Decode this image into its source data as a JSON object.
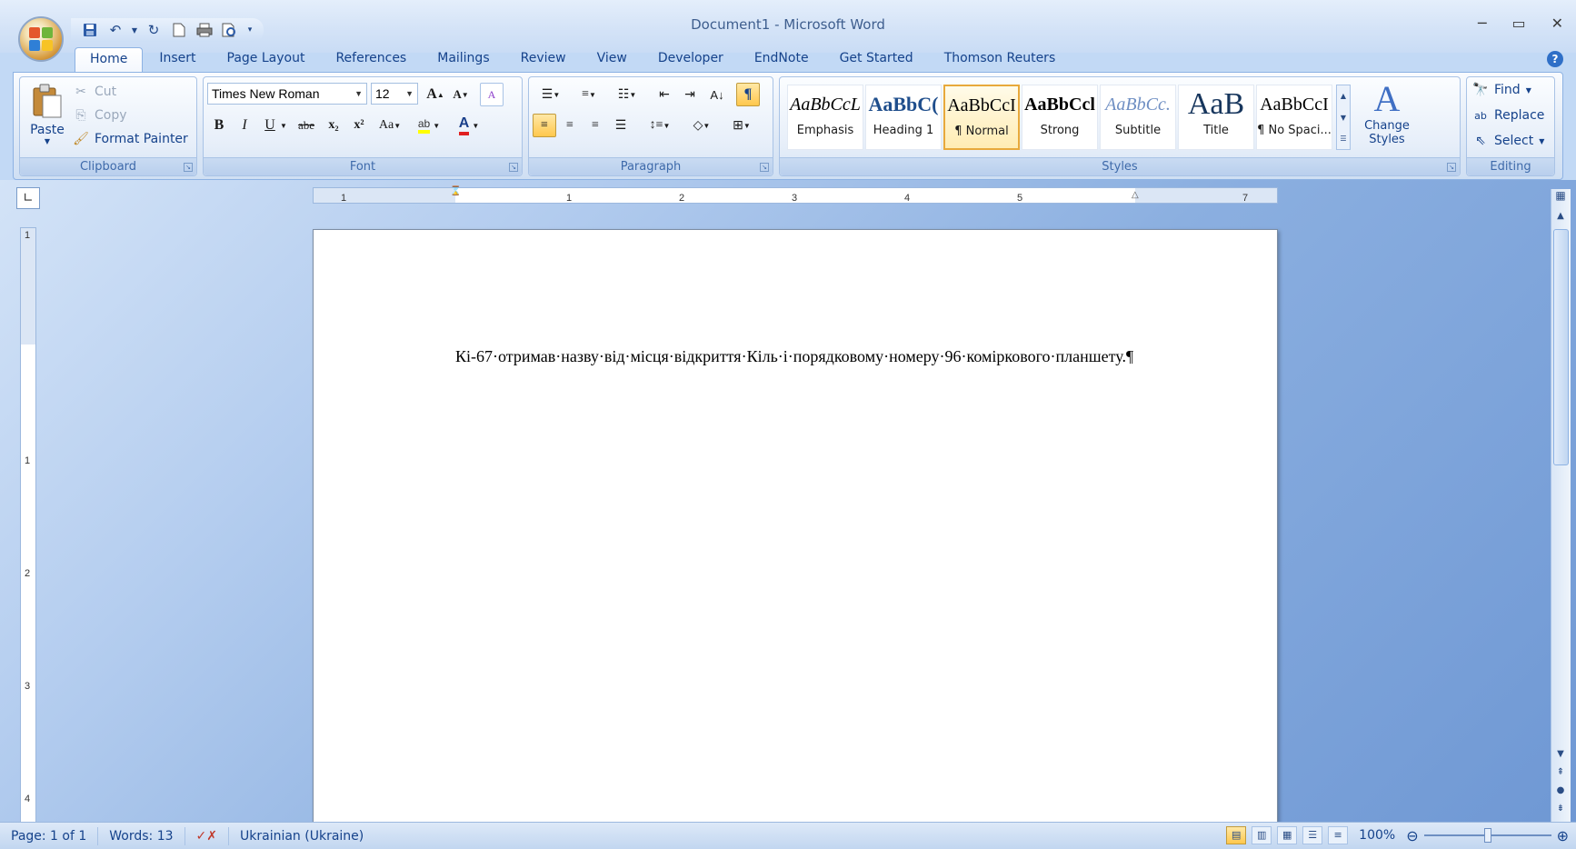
{
  "window": {
    "title": "Document1 - Microsoft Word"
  },
  "qat": {
    "icons": [
      "save-icon",
      "undo-icon",
      "redo-icon",
      "new-icon",
      "print-icon",
      "print-preview-icon"
    ]
  },
  "tabs": [
    {
      "label": "Home",
      "active": true
    },
    {
      "label": "Insert"
    },
    {
      "label": "Page Layout"
    },
    {
      "label": "References"
    },
    {
      "label": "Mailings"
    },
    {
      "label": "Review"
    },
    {
      "label": "View"
    },
    {
      "label": "Developer"
    },
    {
      "label": "EndNote"
    },
    {
      "label": "Get Started"
    },
    {
      "label": "Thomson Reuters"
    }
  ],
  "clipboard": {
    "label": "Clipboard",
    "paste": "Paste",
    "cut": "Cut",
    "copy": "Copy",
    "format_painter": "Format Painter"
  },
  "font": {
    "label": "Font",
    "family": "Times New Roman",
    "size": "12",
    "bold": "B",
    "italic": "I",
    "underline": "U",
    "strike": "abe",
    "subscript": "x₂",
    "superscript": "x²",
    "case": "Aa",
    "grow": "A",
    "shrink": "A",
    "clear": "A",
    "highlight": "ab",
    "color": "A"
  },
  "paragraph": {
    "label": "Paragraph",
    "show_marks": "¶"
  },
  "styles": {
    "label": "Styles",
    "items": [
      {
        "sample": "AaBbCcL",
        "name": "Emphasis"
      },
      {
        "sample": "AaBbC(",
        "name": "Heading 1"
      },
      {
        "sample": "AaBbCcI",
        "name": "¶ Normal",
        "selected": true
      },
      {
        "sample": "AaBbCcl",
        "name": "Strong"
      },
      {
        "sample": "AaBbCc.",
        "name": "Subtitle"
      },
      {
        "sample": "AaB",
        "name": "Title"
      },
      {
        "sample": "AaBbCcI",
        "name": "¶ No Spaci..."
      }
    ],
    "change_styles": "Change Styles"
  },
  "editing": {
    "label": "Editing",
    "find": "Find",
    "replace": "Replace",
    "select": "Select"
  },
  "ruler": {
    "h_ticks": [
      "1",
      "1",
      "2",
      "3",
      "4",
      "5",
      "7"
    ],
    "v_ticks": [
      "1",
      "1",
      "2",
      "3",
      "4"
    ]
  },
  "document": {
    "text": "Кі-67·отримав·назву·від·місця·відкриття·Кіль·і·порядковому·номеру·96·коміркового·планшету.¶"
  },
  "status": {
    "page": "Page: 1 of 1",
    "words": "Words: 13",
    "language": "Ukrainian (Ukraine)",
    "zoom": "100%",
    "zoom_level": 100
  }
}
